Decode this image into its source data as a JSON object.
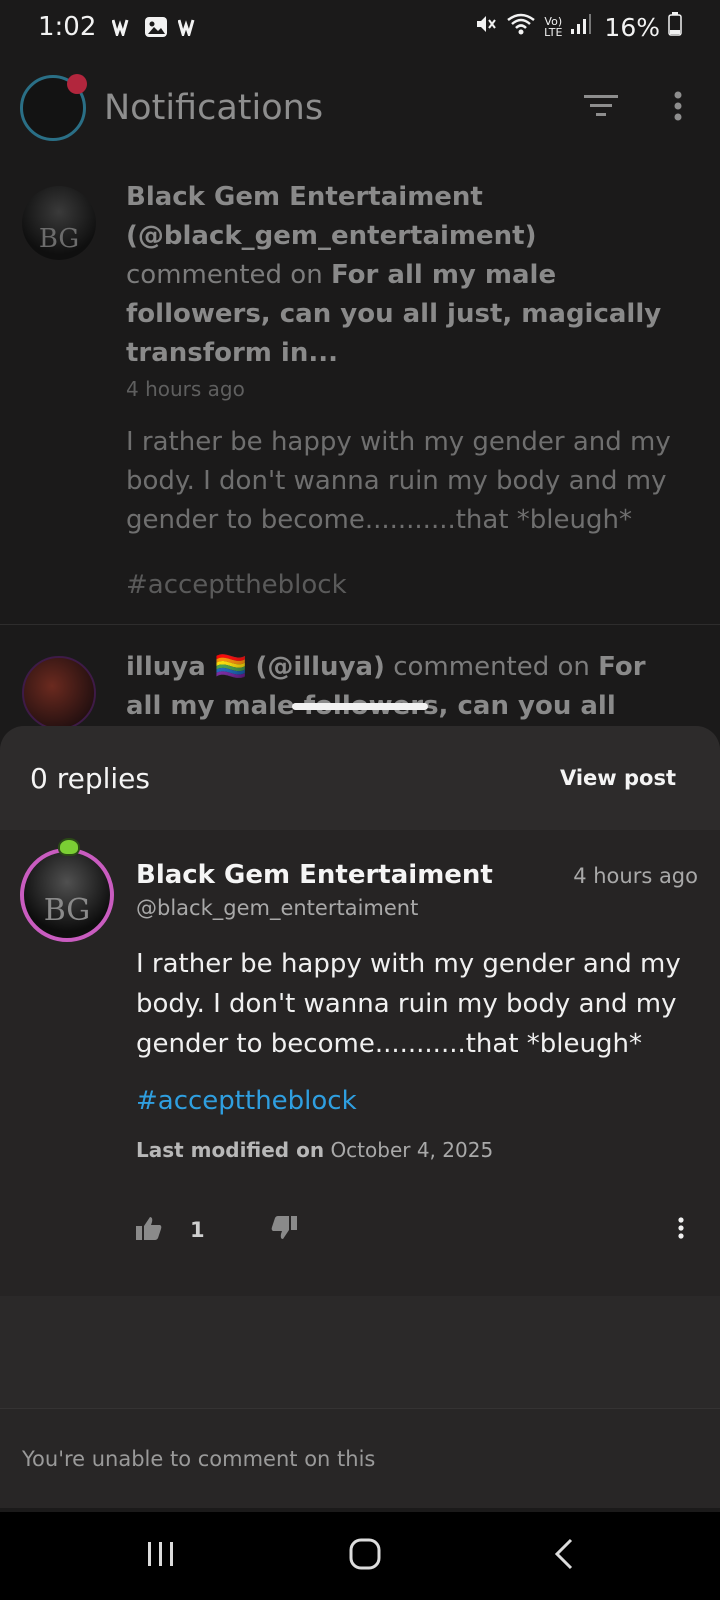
{
  "status_bar": {
    "time": "1:02",
    "battery": "16%",
    "left_icons": [
      "webtoon-icon",
      "image-icon",
      "webtoon-icon"
    ],
    "right_icons": [
      "mute-icon",
      "wifi-icon",
      "volte-icon",
      "signal-icon",
      "battery-icon"
    ]
  },
  "app_bar": {
    "title": "Notifications",
    "actions": [
      "filter-icon",
      "more-vert-icon"
    ]
  },
  "notifications": [
    {
      "author": "Black Gem Entertaiment",
      "handle": "(@black_gem_entertaiment)",
      "action": "commented on",
      "post": "For all my male followers, can you all just, magically transform in...",
      "time": "4 hours ago",
      "body": "I rather be happy with my gender and my body. I don't wanna ruin my body and my gender to become...........that *bleugh*",
      "tag": "#accepttheblock"
    },
    {
      "author": "illuya 🏳️‍🌈",
      "handle": "(@illuya)",
      "action": "commented on",
      "post": "For all my male followers, can you all"
    }
  ],
  "sheet": {
    "replies": "0 replies",
    "view_post": "View post",
    "comment": {
      "author": "Black Gem Entertaiment",
      "handle": "@black_gem_entertaiment",
      "time": "4 hours ago",
      "body": "I rather be happy with my gender and my body. I don't wanna ruin my body and my gender to become...........that *bleugh*",
      "tag": "#accepttheblock",
      "modified_label": "Last modified on",
      "modified_date": "October 4, 2025",
      "likes": "1"
    },
    "footer": "You're unable to comment on this"
  },
  "nav_bar": [
    "recents-icon",
    "home-icon",
    "back-icon"
  ],
  "colors": {
    "background": "#1b1a1a",
    "sheet": "#262424",
    "hashtag": "#2f9fe0",
    "avatar_ring": "#c95cc0",
    "badge": "#b2263d"
  }
}
